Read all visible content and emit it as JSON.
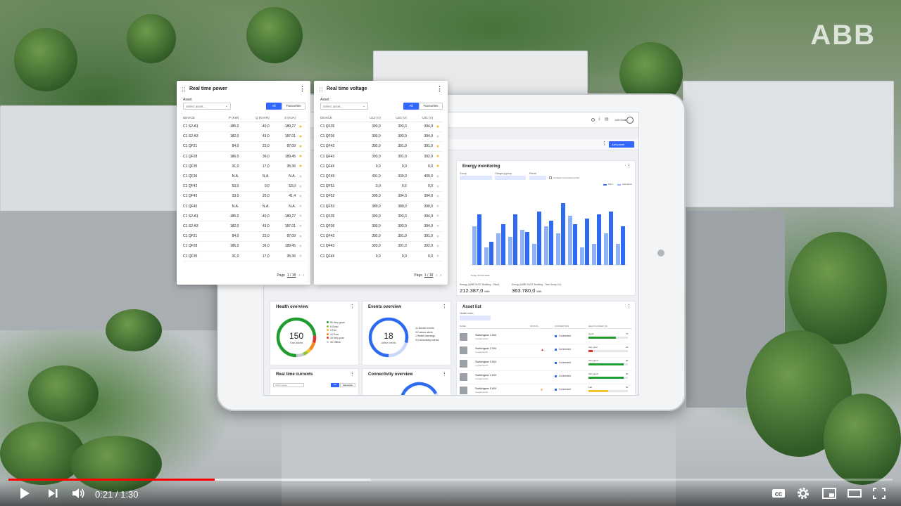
{
  "brand": "ABB",
  "panel_power": {
    "title": "Real time power",
    "asset_label": "Asset",
    "select_placeholder": "Select asset...",
    "btn_all": "All",
    "btn_fav": "Favourites",
    "columns": [
      "DEVICE",
      "P (KW)",
      "Q (KVAR)",
      "S (KVA)"
    ],
    "rows": [
      [
        "C1 S2-A1",
        "-185,0",
        "-40,0",
        "-189,27",
        true
      ],
      [
        "C1 S2-A3",
        "182,0",
        "43,0",
        "187,01",
        true
      ],
      [
        "C1 QF21",
        "84,0",
        "23,0",
        "87,09",
        true
      ],
      [
        "C1 QF28",
        "186,0",
        "36,0",
        "189,45",
        true
      ],
      [
        "C1 QF35",
        "31,0",
        "17,0",
        "35,36",
        true
      ],
      [
        "C1 QF36",
        "N.A.",
        "N.A.",
        "N.A.",
        false
      ],
      [
        "C1 QF42",
        "53,0",
        "0,0",
        "53,0",
        false
      ],
      [
        "C1 QF43",
        "33,0",
        "25,0",
        "41,4",
        false
      ],
      [
        "C1 QF45",
        "N.A.",
        "N.A.",
        "N.A.",
        false
      ],
      [
        "C1 S2-A1",
        "-185,0",
        "-40,0",
        "-189,27",
        false
      ],
      [
        "C1 S2-A3",
        "182,0",
        "43,0",
        "187,01",
        false
      ],
      [
        "C1 QF21",
        "84,0",
        "23,0",
        "87,09",
        false
      ],
      [
        "C1 QF28",
        "186,0",
        "36,0",
        "189,45",
        false
      ],
      [
        "C1 QF35",
        "31,0",
        "17,0",
        "35,36",
        false
      ]
    ],
    "page_label": "Page",
    "page_value": "1 / 18"
  },
  "panel_voltage": {
    "title": "Real time voltage",
    "asset_label": "Asset",
    "select_placeholder": "Select asset...",
    "btn_all": "All",
    "btn_fav": "Favourites",
    "columns": [
      "DEVICE",
      "U12 (V)",
      "U23 (V)",
      "U31 (V)"
    ],
    "rows": [
      [
        "C1 QF35",
        "393,0",
        "393,0",
        "394,0",
        true
      ],
      [
        "C1 QF36",
        "393,0",
        "393,0",
        "394,0",
        false
      ],
      [
        "C1 QF42",
        "392,0",
        "391,0",
        "391,0",
        true
      ],
      [
        "C1 QF43",
        "393,0",
        "391,0",
        "392,0",
        true
      ],
      [
        "C1 QF45",
        "0,0",
        "0,0",
        "0,0",
        true
      ],
      [
        "C1 QF49",
        "401,0",
        "339,0",
        "400,0",
        false
      ],
      [
        "C1 QF51",
        "0,0",
        "0,0",
        "0,0",
        false
      ],
      [
        "C1 QF52",
        "395,0",
        "394,0",
        "394,0",
        false
      ],
      [
        "C1 QF53",
        "389,0",
        "389,0",
        "390,0",
        false
      ],
      [
        "C1 QF35",
        "393,0",
        "393,0",
        "394,0",
        false
      ],
      [
        "C1 QF36",
        "393,0",
        "393,0",
        "394,0",
        false
      ],
      [
        "C1 QF42",
        "392,0",
        "391,0",
        "391,0",
        false
      ],
      [
        "C1 QF43",
        "393,0",
        "391,0",
        "392,0",
        false
      ],
      [
        "C1 QF45",
        "0,0",
        "0,0",
        "0,0",
        false
      ]
    ],
    "page_label": "Page",
    "page_value": "1 / 18"
  },
  "dashboard": {
    "add_panel": "Add panel",
    "energy": {
      "title": "Energy monitoring",
      "group_label": "Group",
      "category_label": "Category group",
      "period_label": "Period",
      "compare_label": "Compare to previous period",
      "legend_a": "Plant",
      "legend_b": "Substation",
      "date_label": "Today, 24 Feb 2020",
      "total_a_label": "Energy (ABB SACE Building - Plant)",
      "total_a_value": "212.387,0",
      "total_a_unit": "kWh",
      "total_b_label": "Energy (ABB SACE Building - Test Group 01)",
      "total_b_value": "363.780,0",
      "total_b_unit": "kWh",
      "bars_a": [
        0.55,
        0.25,
        0.45,
        0.4,
        0.5,
        0.3,
        0.55,
        0.45,
        0.7,
        0.25,
        0.3,
        0.45,
        0.3
      ],
      "bars_b": [
        0.72,
        0.33,
        0.58,
        0.72,
        0.47,
        0.76,
        0.63,
        0.88,
        0.58,
        0.66,
        0.72,
        0.76,
        0.55
      ]
    },
    "health": {
      "title": "Health overview",
      "total": "150",
      "total_label": "Total assets",
      "legend": [
        "80 Very good",
        "6 Good",
        "4 Fair",
        "10 Poor",
        "10 Very poor",
        "30 Offline"
      ],
      "colors": [
        "#1f9d2e",
        "#8cc43a",
        "#f2c12e",
        "#f08a24",
        "#e0322f",
        "#c9ccd1"
      ]
    },
    "events": {
      "title": "Events overview",
      "total": "18",
      "total_label": "Active events",
      "legend": [
        "11 Device events",
        "3 Custom alerts",
        "1 Health warnings",
        "3 Connectivity events"
      ]
    },
    "asset_list": {
      "title": "Asset list",
      "filter_label": "Health index",
      "columns": [
        "NAME",
        "STATUS",
        "CONNECTION",
        "HEALTH INDEX (%)"
      ],
      "rows": [
        {
          "name": "Switchgear 1 MV",
          "sub": "4 equipments",
          "status": "",
          "conn": "Connected",
          "health": "Good",
          "pct": "70",
          "fill": 0.7,
          "color": "#1f9d2e"
        },
        {
          "name": "Switchgear 2 MV",
          "sub": "4 equipments",
          "status": "▲",
          "conn": "Connected",
          "health": "Very poor",
          "pct": "10",
          "fill": 0.1,
          "color": "#e0322f"
        },
        {
          "name": "Switchgear 3 MV",
          "sub": "4 equipments",
          "status": "",
          "conn": "Connected",
          "health": "Very good",
          "pct": "90",
          "fill": 0.9,
          "color": "#1f9d2e"
        },
        {
          "name": "Switchgear 4 MV",
          "sub": "4 equipments",
          "status": "",
          "conn": "Connected",
          "health": "Very good",
          "pct": "90",
          "fill": 0.9,
          "color": "#1f9d2e"
        },
        {
          "name": "Switchgear 5 MV",
          "sub": "4 equipments",
          "status": "●",
          "conn": "Connected",
          "health": "Fair",
          "pct": "50",
          "fill": 0.5,
          "color": "#f2c12e"
        }
      ]
    },
    "currents": {
      "title": "Real time currents",
      "btn_all": "All",
      "btn_fav": "Favourites",
      "select_placeholder": "Select asset..."
    },
    "connectivity": {
      "title": "Connectivity overview"
    },
    "user": "John Smith"
  },
  "player": {
    "time_current": "0:21",
    "time_total": "1:30",
    "progress": 0.2333,
    "buffered": 0.41
  }
}
